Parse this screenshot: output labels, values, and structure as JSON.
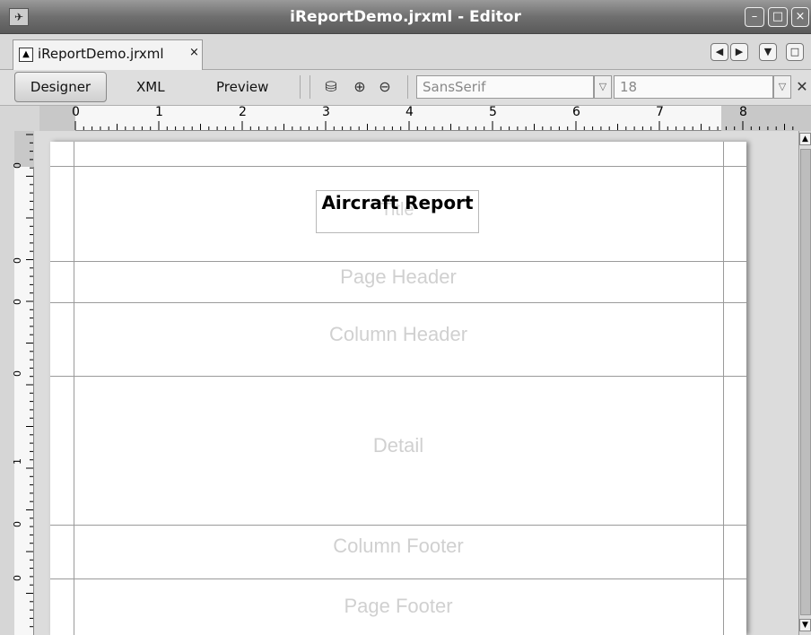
{
  "window": {
    "title": "iReportDemo.jrxml - Editor"
  },
  "document_tab": {
    "label": "iReportDemo.jrxml",
    "close": "×"
  },
  "toolbar": {
    "designer": "Designer",
    "xml": "XML",
    "preview": "Preview",
    "font_family": "SansSerif",
    "font_size": "18"
  },
  "ruler": {
    "horizontal": [
      "0",
      "1",
      "2",
      "3",
      "4",
      "5",
      "6",
      "7",
      "8"
    ],
    "vertical": [
      "0",
      "0",
      "0",
      "0",
      "1",
      "0",
      "0"
    ]
  },
  "report": {
    "title_field_placeholder": "Title",
    "title_field_text": "Aircraft Report",
    "bands": {
      "page_header": "Page Header",
      "column_header": "Column Header",
      "detail": "Detail",
      "column_footer": "Column Footer",
      "page_footer": "Page Footer"
    }
  },
  "icons": [
    "app-icon",
    "document-icon",
    "close-icon",
    "nav-left-icon",
    "nav-right-icon",
    "dropdown-icon",
    "maximize-icon",
    "database-icon",
    "zoom-in-icon",
    "zoom-out-icon",
    "chevron-down-icon"
  ]
}
